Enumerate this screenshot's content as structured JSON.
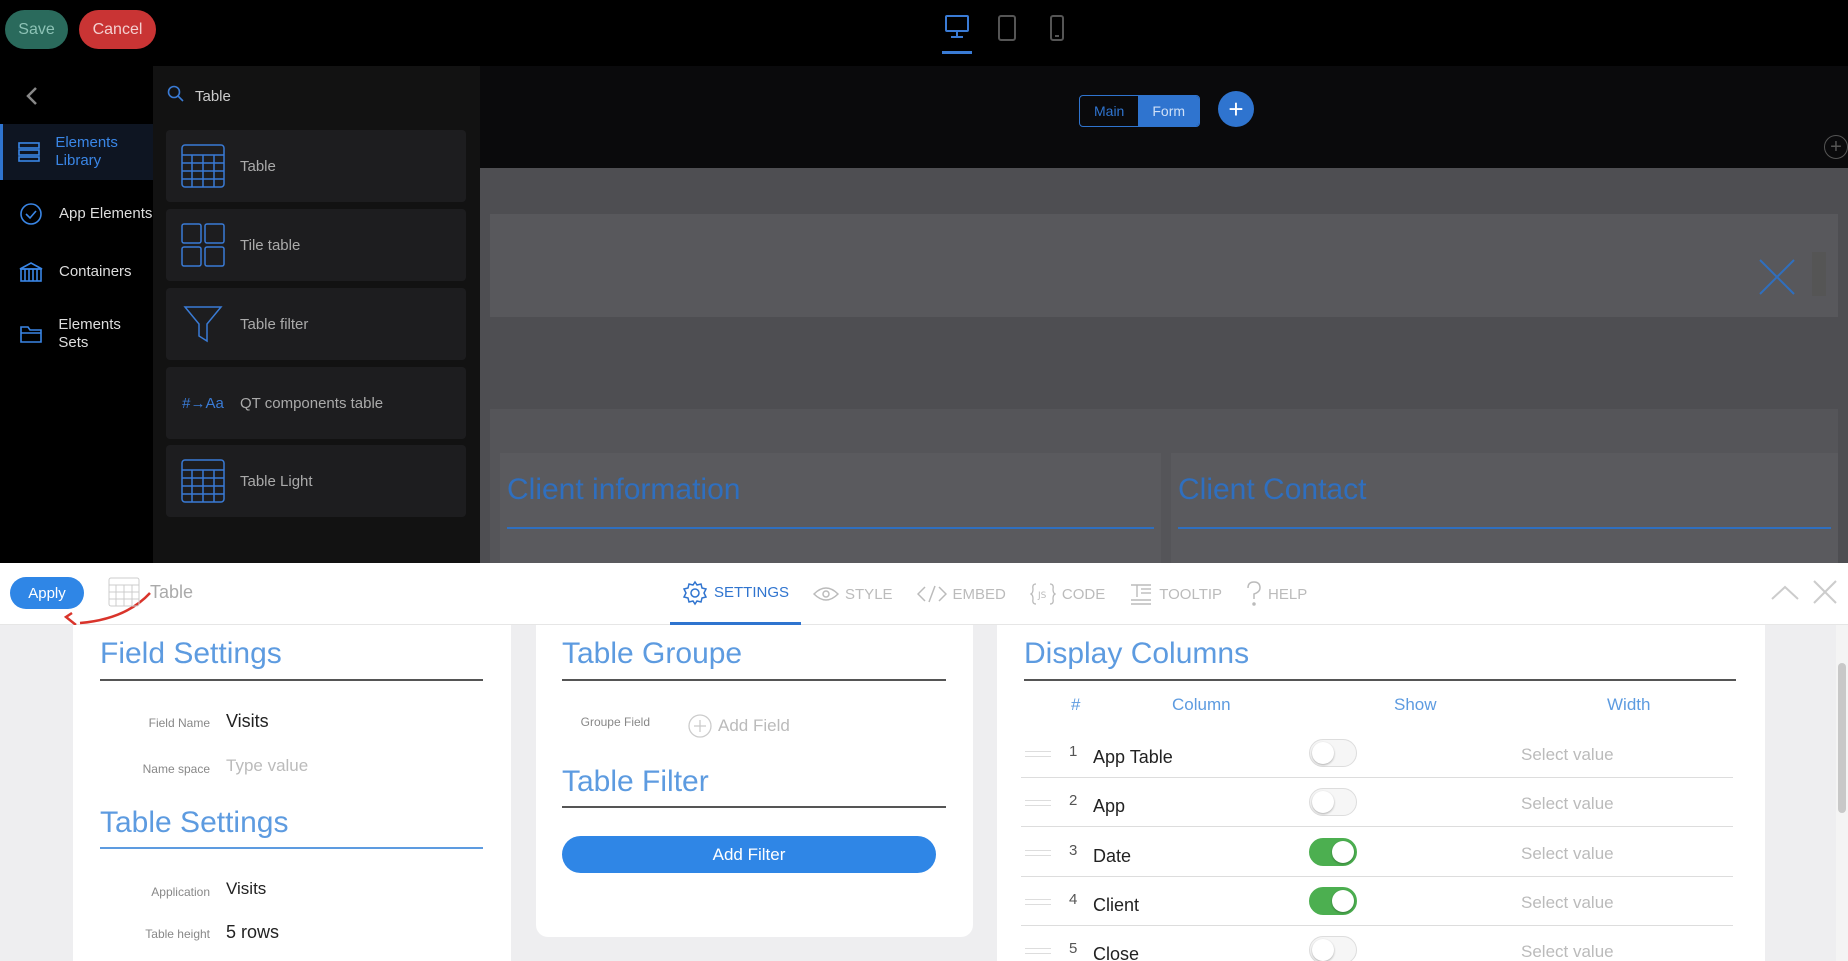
{
  "toolbar": {
    "save_label": "Save",
    "cancel_label": "Cancel"
  },
  "devices": [
    "desktop-icon",
    "tablet-icon",
    "mobile-icon"
  ],
  "sidebar": {
    "items": [
      {
        "label": "Elements Library",
        "icon": "layers-icon",
        "active": true
      },
      {
        "label": "App Elements",
        "icon": "check-circle-icon",
        "active": false
      },
      {
        "label": "Containers",
        "icon": "container-icon",
        "active": false
      },
      {
        "label": "Elements Sets",
        "icon": "folder-icon",
        "active": false
      }
    ]
  },
  "library": {
    "search_value": "Table",
    "items": [
      {
        "label": "Table",
        "icon": "table-grid-icon"
      },
      {
        "label": "Tile table",
        "icon": "tile-grid-icon"
      },
      {
        "label": "Table filter",
        "icon": "funnel-icon"
      },
      {
        "label": "QT components table",
        "icon": "qt-components-icon",
        "icon_text": "#→Aa"
      },
      {
        "label": "Table Light",
        "icon": "table-grid-icon"
      }
    ]
  },
  "canvas": {
    "view_tabs": [
      "Main",
      "Form"
    ],
    "active_view": "Form",
    "add_label": "+",
    "cards": [
      "Client information",
      "Client Contact"
    ]
  },
  "panel": {
    "apply_label": "Apply",
    "element_title": "Table",
    "tabs": [
      {
        "label": "SETTINGS",
        "icon": "gear-icon",
        "active": true
      },
      {
        "label": "STYLE",
        "icon": "eye-icon",
        "active": false
      },
      {
        "label": "EMBED",
        "icon": "embed-code-icon",
        "active": false
      },
      {
        "label": "CODE",
        "icon": "js-code-icon",
        "active": false
      },
      {
        "label": "TOOLTIP",
        "icon": "tooltip-icon",
        "active": false
      },
      {
        "label": "HELP",
        "icon": "question-icon",
        "active": false
      }
    ],
    "field_settings": {
      "title": "Field Settings",
      "field_name_label": "Field Name",
      "field_name_value": "Visits",
      "namespace_label": "Name space",
      "namespace_placeholder": "Type value"
    },
    "table_settings": {
      "title": "Table Settings",
      "application_label": "Application",
      "application_value": "Visits",
      "height_label": "Table height",
      "height_value": "5 rows"
    },
    "table_groupe": {
      "title": "Table Groupe",
      "field_label": "Groupe Field",
      "add_field_label": "Add Field"
    },
    "table_filter": {
      "title": "Table Filter",
      "add_filter_label": "Add Filter"
    },
    "display_columns": {
      "title": "Display Columns",
      "headers": [
        "#",
        "Column",
        "Show",
        "Width"
      ],
      "rows": [
        {
          "num": "1",
          "name": "App Table",
          "show": false,
          "width": "Select value"
        },
        {
          "num": "2",
          "name": "App",
          "show": false,
          "width": "Select value"
        },
        {
          "num": "3",
          "name": "Date",
          "show": true,
          "width": "Select value"
        },
        {
          "num": "4",
          "name": "Client",
          "show": true,
          "width": "Select value"
        },
        {
          "num": "5",
          "name": "Close",
          "show": false,
          "width": "Select value"
        }
      ]
    }
  },
  "colors": {
    "accent": "#2f86e6",
    "toggle_on": "#4caf50",
    "danger": "#c93434"
  }
}
